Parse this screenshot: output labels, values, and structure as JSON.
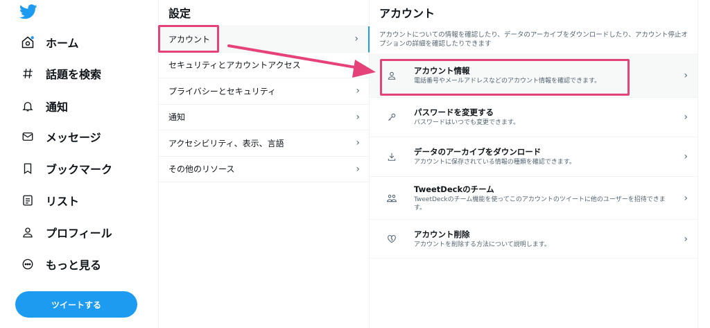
{
  "nav": {
    "items": [
      {
        "label": "ホーム",
        "icon": "home-icon"
      },
      {
        "label": "話題を検索",
        "icon": "hashtag-icon"
      },
      {
        "label": "通知",
        "icon": "bell-icon"
      },
      {
        "label": "メッセージ",
        "icon": "mail-icon"
      },
      {
        "label": "ブックマーク",
        "icon": "bookmark-icon"
      },
      {
        "label": "リスト",
        "icon": "list-icon"
      },
      {
        "label": "プロフィール",
        "icon": "person-icon"
      },
      {
        "label": "もっと見る",
        "icon": "more-icon"
      }
    ],
    "tweet_button": "ツイートする"
  },
  "settings": {
    "title": "設定",
    "items": [
      {
        "label": "アカウント"
      },
      {
        "label": "セキュリティとアカウントアクセス"
      },
      {
        "label": "プライバシーとセキュリティ"
      },
      {
        "label": "通知"
      },
      {
        "label": "アクセシビリティ、表示、言語"
      },
      {
        "label": "その他のリソース"
      }
    ]
  },
  "account": {
    "title": "アカウント",
    "description": "アカウントについての情報を確認したり、データのアーカイブをダウンロードしたり、アカウント停止オプションの詳細を確認したりできます",
    "items": [
      {
        "title": "アカウント情報",
        "subtitle": "電話番号やメールアドレスなどのアカウント情報を確認できます。",
        "icon": "person-icon"
      },
      {
        "title": "パスワードを変更する",
        "subtitle": "パスワードはいつでも変更できます。",
        "icon": "key-icon"
      },
      {
        "title": "データのアーカイブをダウンロード",
        "subtitle": "アカウントに保存されている情報の種類を確認できます。",
        "icon": "download-icon"
      },
      {
        "title": "TweetDeckのチーム",
        "subtitle": "TweetDeckのチーム機能を使ってこのアカウントのツイートに他のユーザーを招待できます。",
        "icon": "team-icon"
      },
      {
        "title": "アカウント削除",
        "subtitle": "アカウントを削除する方法について説明します。",
        "icon": "broken-heart-icon"
      }
    ]
  },
  "colors": {
    "accent": "#1d9bf0",
    "highlight": "#e6427a",
    "text_secondary": "#536471"
  }
}
